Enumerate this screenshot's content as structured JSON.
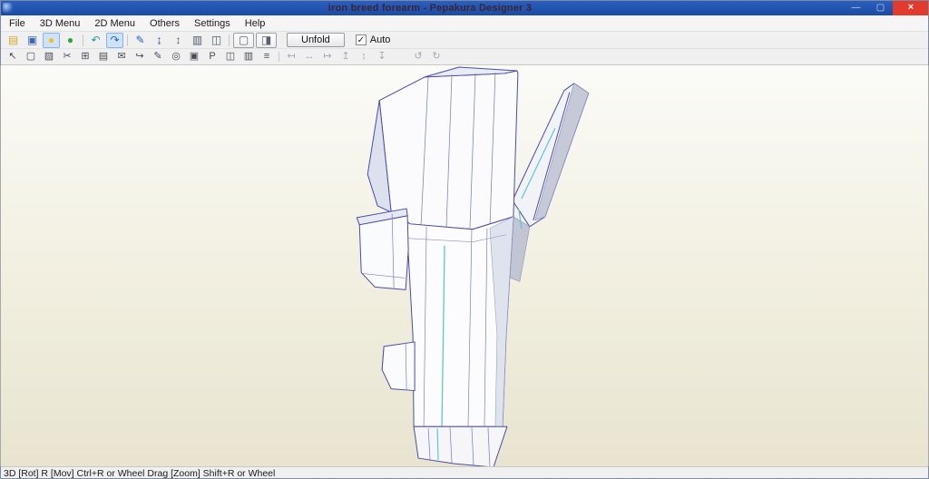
{
  "window": {
    "title": "iron breed forearm - Pepakura Designer 3",
    "controls": {
      "minimize": "—",
      "maximize": "▢",
      "close": "×"
    }
  },
  "menu": {
    "items": [
      {
        "label": "File"
      },
      {
        "label": "3D Menu"
      },
      {
        "label": "2D Menu"
      },
      {
        "label": "Others"
      },
      {
        "label": "Settings"
      },
      {
        "label": "Help"
      }
    ]
  },
  "toolbar": {
    "unfold_label": "Unfold",
    "auto_label": "Auto",
    "auto_checked": true,
    "check_glyph": "✓",
    "row1": [
      {
        "name": "open-icon",
        "glyph": "▤",
        "color": "#d9a62e"
      },
      {
        "name": "save-icon",
        "glyph": "▣",
        "color": "#3a67b5"
      },
      {
        "name": "render-light-icon",
        "glyph": "●",
        "color": "#f0c020",
        "selected": true
      },
      {
        "name": "texture-icon",
        "glyph": "●",
        "color": "#35a23a"
      },
      {
        "name": "toolbar-separator",
        "kind": "sep",
        "interactable": false
      },
      {
        "name": "undo-icon",
        "glyph": "↶",
        "color": "#2a9a96"
      },
      {
        "name": "redo-icon",
        "glyph": "↷",
        "color": "#2a62c0",
        "selected": true
      },
      {
        "name": "toolbar-separator",
        "kind": "sep",
        "interactable": false
      },
      {
        "name": "pen-icon",
        "glyph": "✎",
        "color": "#2a62c0"
      },
      {
        "name": "pin-icon",
        "glyph": "↨",
        "color": "#2a62c0"
      },
      {
        "name": "flip-icon",
        "glyph": "↕",
        "color": "#4a5a6a"
      },
      {
        "name": "grid-icon",
        "glyph": "▥",
        "color": "#4a5a6a"
      },
      {
        "name": "panels-icon",
        "glyph": "◫",
        "color": "#4a5a6a"
      },
      {
        "name": "toolbar-separator",
        "kind": "sep",
        "interactable": false
      },
      {
        "name": "view-shaded-button",
        "glyph": "▢",
        "kind": "viewbtn"
      },
      {
        "name": "view-textured-button",
        "glyph": "◨",
        "kind": "viewbtn"
      }
    ],
    "row2": [
      {
        "name": "select-icon",
        "glyph": "↖"
      },
      {
        "name": "lasso-icon",
        "glyph": "▢"
      },
      {
        "name": "edit-mesh-icon",
        "glyph": "▨"
      },
      {
        "name": "cut-edge-icon",
        "glyph": "✂"
      },
      {
        "name": "join-edge-icon",
        "glyph": "⊞"
      },
      {
        "name": "flap-icon",
        "glyph": "▤"
      },
      {
        "name": "note-icon",
        "glyph": "✉"
      },
      {
        "name": "rotate-island-icon",
        "glyph": "↪"
      },
      {
        "name": "edit-text-icon",
        "glyph": "✎"
      },
      {
        "name": "target-icon",
        "glyph": "◎"
      },
      {
        "name": "fill-icon",
        "glyph": "▣"
      },
      {
        "name": "part-number-icon",
        "glyph": "P"
      },
      {
        "name": "two-page-icon",
        "glyph": "◫"
      },
      {
        "name": "page-grid-icon",
        "glyph": "▥"
      },
      {
        "name": "order-icon",
        "glyph": "≡"
      },
      {
        "name": "toolbar-separator",
        "kind": "sep",
        "interactable": false
      },
      {
        "name": "align-left-icon",
        "glyph": "↤",
        "disabled": true
      },
      {
        "name": "align-center-h-icon",
        "glyph": "↔",
        "disabled": true
      },
      {
        "name": "align-right-icon",
        "glyph": "↦",
        "disabled": true
      },
      {
        "name": "align-top-icon",
        "glyph": "↥",
        "disabled": true
      },
      {
        "name": "align-middle-icon",
        "glyph": "↕",
        "disabled": true
      },
      {
        "name": "align-bottom-icon",
        "glyph": "↧",
        "disabled": true
      },
      {
        "name": "toolbar-gap",
        "kind": "gap",
        "interactable": false
      },
      {
        "name": "rotate-left-icon",
        "glyph": "↺",
        "disabled": true
      },
      {
        "name": "rotate-right-icon",
        "glyph": "↻",
        "disabled": true
      }
    ]
  },
  "statusbar": {
    "text": "3D [Rot] R [Mov] Ctrl+R or Wheel Drag [Zoom] Shift+R or Wheel"
  },
  "colors": {
    "titlebar_blue": "#1f55b2",
    "close_red": "#e23b2e",
    "canvas_beige": "#e8e4d0",
    "model_stroke_navy": "#4a4aae",
    "model_accent_cyan": "#55c8dc",
    "selection_highlight": "#cfe3f8"
  }
}
